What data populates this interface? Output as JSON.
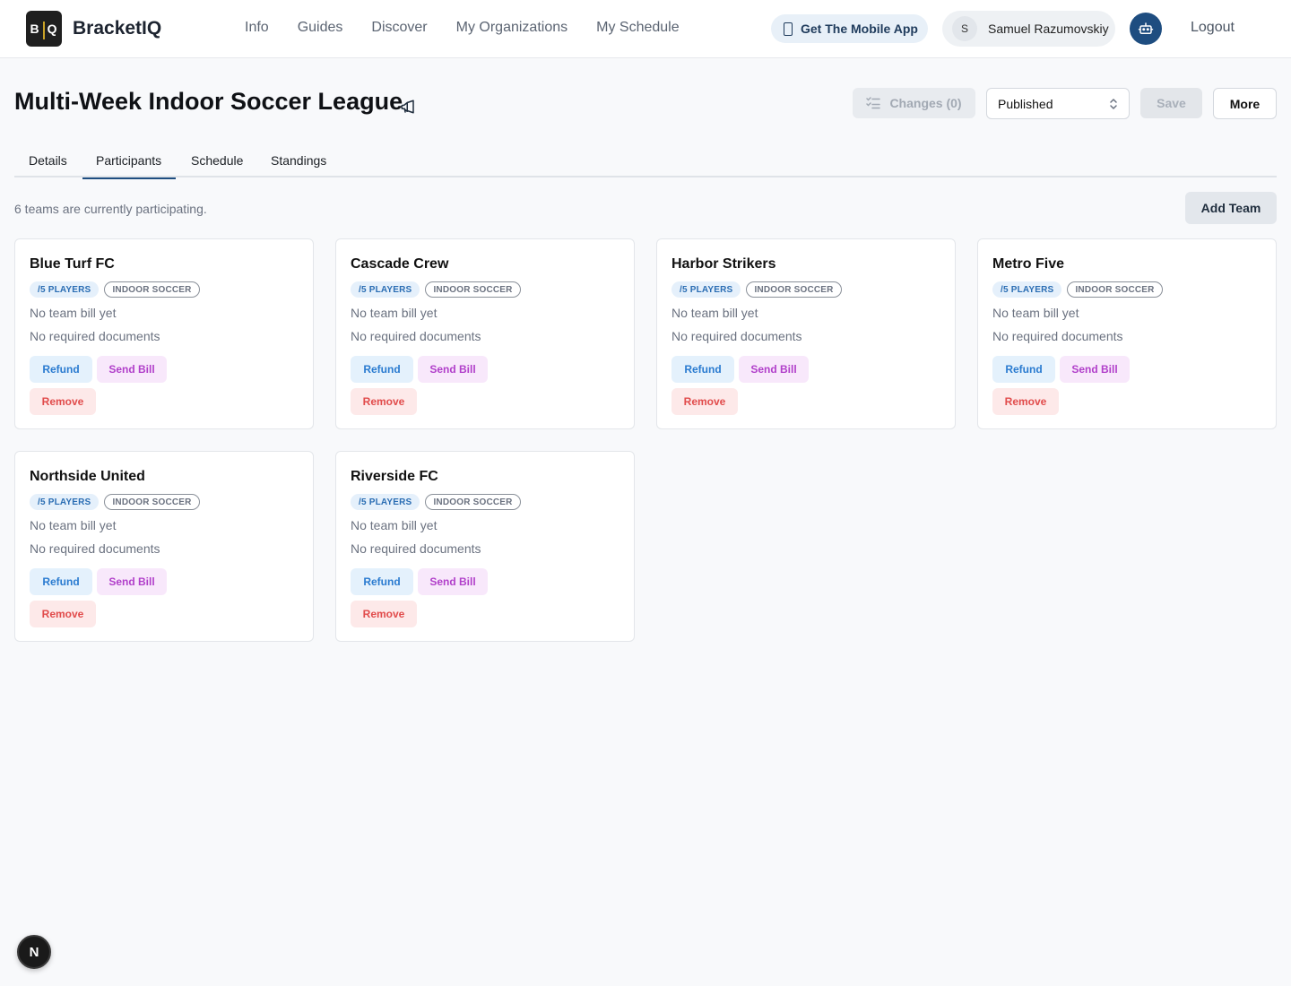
{
  "app": {
    "logo_left": "B",
    "logo_right": "Q",
    "name": "BracketIQ"
  },
  "nav": [
    "Info",
    "Guides",
    "Discover",
    "My Organizations",
    "My Schedule"
  ],
  "header": {
    "mobile_app_label": "Get The Mobile App",
    "user_initial": "S",
    "user_name": "Samuel Razumovskiy",
    "logout_label": "Logout"
  },
  "page": {
    "title": "Multi-Week Indoor Soccer League",
    "changes_label": "Changes (0)",
    "status_value": "Published",
    "save_label": "Save",
    "more_label": "More"
  },
  "tabs": [
    "Details",
    "Participants",
    "Schedule",
    "Standings"
  ],
  "active_tab": "Participants",
  "participants": {
    "summary": "6 teams are currently participating.",
    "add_team_label": "Add Team",
    "teams": [
      {
        "name": "Blue Turf FC",
        "players": "/5 PLAYERS",
        "sport": "INDOOR SOCCER",
        "bill": "No team bill yet",
        "docs": "No required documents"
      },
      {
        "name": "Cascade Crew",
        "players": "/5 PLAYERS",
        "sport": "INDOOR SOCCER",
        "bill": "No team bill yet",
        "docs": "No required documents"
      },
      {
        "name": "Harbor Strikers",
        "players": "/5 PLAYERS",
        "sport": "INDOOR SOCCER",
        "bill": "No team bill yet",
        "docs": "No required documents"
      },
      {
        "name": "Metro Five",
        "players": "/5 PLAYERS",
        "sport": "INDOOR SOCCER",
        "bill": "No team bill yet",
        "docs": "No required documents"
      },
      {
        "name": "Northside United",
        "players": "/5 PLAYERS",
        "sport": "INDOOR SOCCER",
        "bill": "No team bill yet",
        "docs": "No required documents"
      },
      {
        "name": "Riverside FC",
        "players": "/5 PLAYERS",
        "sport": "INDOOR SOCCER",
        "bill": "No team bill yet",
        "docs": "No required documents"
      }
    ],
    "card_actions": {
      "refund": "Refund",
      "send_bill": "Send Bill",
      "remove": "Remove"
    }
  },
  "dev_badge": "N",
  "colors": {
    "accent": "#1e4d80",
    "refund": "#2a7bd0",
    "send_bill": "#b13fca",
    "remove": "#e14b4b"
  }
}
